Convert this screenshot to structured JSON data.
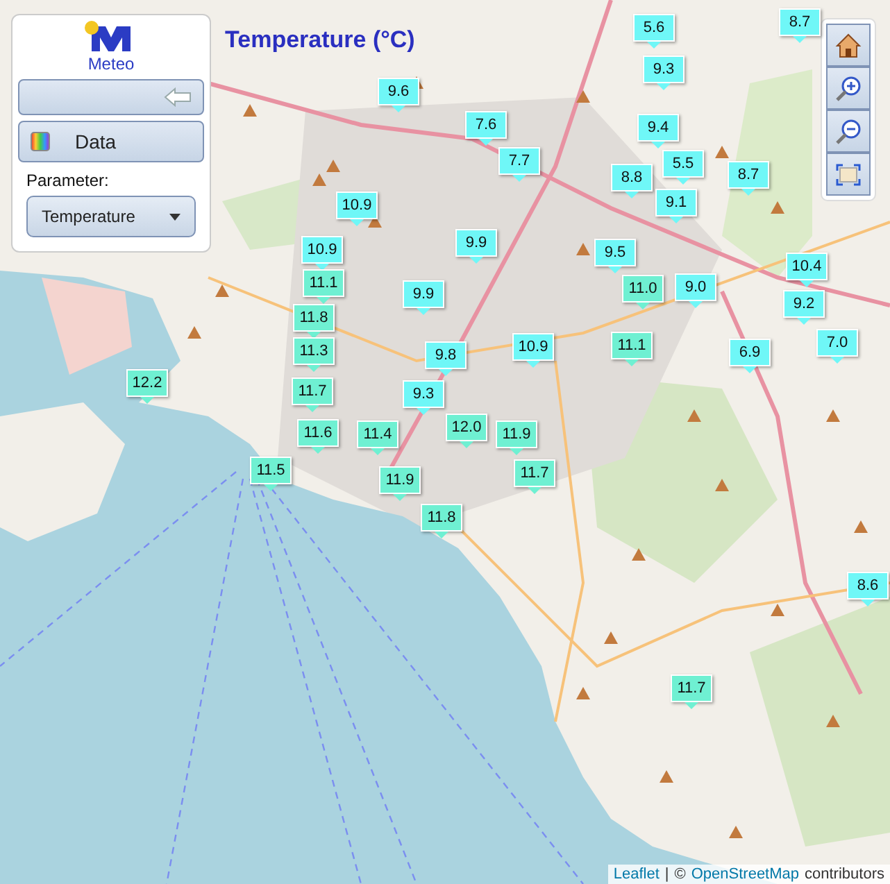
{
  "logo": {
    "text": "Meteo"
  },
  "title": "Temperature (°C)",
  "panel": {
    "data_button": "Data",
    "parameter_label": "Parameter:",
    "parameter_select": "Temperature"
  },
  "markers": [
    {
      "value": "5.6",
      "color": "#6ff7f7"
    },
    {
      "value": "8.7",
      "color": "#6ff7f7"
    },
    {
      "value": "9.3",
      "color": "#6ff7f7"
    },
    {
      "value": "9.6",
      "color": "#6ff7f7"
    },
    {
      "value": "7.6",
      "color": "#6ff7f7"
    },
    {
      "value": "9.4",
      "color": "#6ff7f7"
    },
    {
      "value": "5.5",
      "color": "#6ff7f7"
    },
    {
      "value": "7.7",
      "color": "#6ff7f7"
    },
    {
      "value": "8.8",
      "color": "#6ff7f7"
    },
    {
      "value": "8.7",
      "color": "#6ff7f7"
    },
    {
      "value": "9.1",
      "color": "#6ff7f7"
    },
    {
      "value": "10.9",
      "color": "#6ff7f7"
    },
    {
      "value": "9.9",
      "color": "#6ff7f7"
    },
    {
      "value": "10.9",
      "color": "#6ff7f7"
    },
    {
      "value": "9.5",
      "color": "#6ff7f7"
    },
    {
      "value": "11.1",
      "color": "#6ff0d2"
    },
    {
      "value": "11.0",
      "color": "#6ff0d2"
    },
    {
      "value": "9.0",
      "color": "#6ff7f7"
    },
    {
      "value": "9.9",
      "color": "#6ff7f7"
    },
    {
      "value": "10.4",
      "color": "#6ff7f7"
    },
    {
      "value": "9.2",
      "color": "#6ff7f7"
    },
    {
      "value": "11.8",
      "color": "#6ff0d2"
    },
    {
      "value": "11.3",
      "color": "#6ff0d2"
    },
    {
      "value": "9.8",
      "color": "#6ff7f7"
    },
    {
      "value": "10.9",
      "color": "#6ff7f7"
    },
    {
      "value": "11.1",
      "color": "#6ff0d2"
    },
    {
      "value": "7.0",
      "color": "#6ff7f7"
    },
    {
      "value": "6.9",
      "color": "#6ff7f7"
    },
    {
      "value": "12.2",
      "color": "#6ff0d2"
    },
    {
      "value": "11.7",
      "color": "#6ff0d2"
    },
    {
      "value": "9.3",
      "color": "#6ff7f7"
    },
    {
      "value": "12.0",
      "color": "#6ff0d2"
    },
    {
      "value": "11.6",
      "color": "#6ff0d2"
    },
    {
      "value": "11.4",
      "color": "#6ff0d2"
    },
    {
      "value": "11.9",
      "color": "#6ff0d2"
    },
    {
      "value": "11.5",
      "color": "#6ff0d2"
    },
    {
      "value": "11.7",
      "color": "#6ff0d2"
    },
    {
      "value": "11.9",
      "color": "#6ff0d2"
    },
    {
      "value": "11.8",
      "color": "#6ff0d2"
    },
    {
      "value": "11.7",
      "color": "#6ff0d2"
    },
    {
      "value": "8.6",
      "color": "#6ff7f7"
    }
  ],
  "attribution": {
    "leaflet_link": "Leaflet",
    "separator": "|",
    "copyright": "©",
    "osm_link": "OpenStreetMap",
    "suffix": "contributors"
  }
}
